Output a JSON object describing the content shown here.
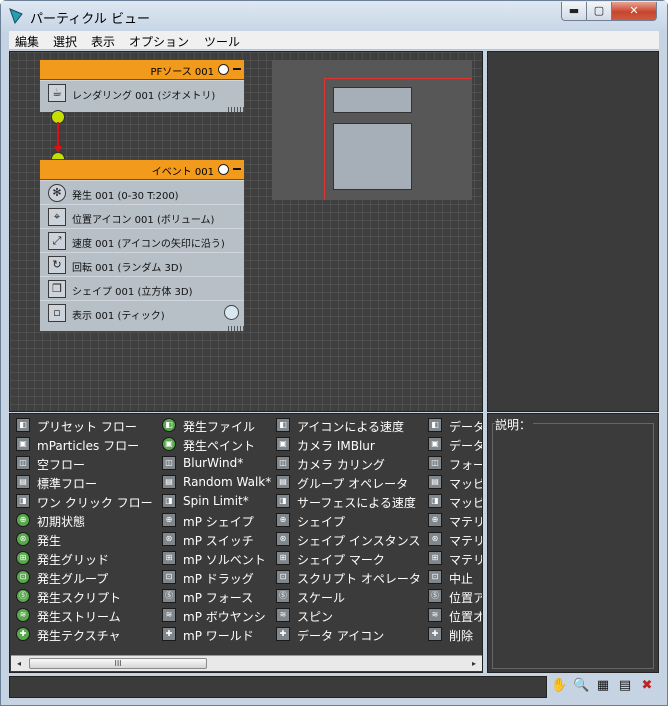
{
  "window": {
    "title": "パーティクル ビュー",
    "min_glyph": "▬",
    "max_glyph": "▢",
    "close_glyph": "✕"
  },
  "menu": [
    "編集",
    "選択",
    "表示",
    "オプション",
    "ツール"
  ],
  "source_node": {
    "title": "PFソース 001",
    "operators": [
      {
        "label": "レンダリング 001 (ジオメトリ)",
        "icon": "render-icon"
      }
    ]
  },
  "event_node": {
    "title": "イベント 001",
    "operators": [
      {
        "label": "発生 001 (0-30 T:200)",
        "icon": "birth-icon"
      },
      {
        "label": "位置アイコン 001 (ボリューム)",
        "icon": "position-icon"
      },
      {
        "label": "速度 001 (アイコンの矢印に沿う)",
        "icon": "speed-icon"
      },
      {
        "label": "回転 001 (ランダム 3D)",
        "icon": "rotation-icon"
      },
      {
        "label": "シェイプ 001 (立方体 3D)",
        "icon": "shape-icon"
      },
      {
        "label": "表示 001 (ティック)",
        "icon": "display-icon"
      }
    ]
  },
  "depot": {
    "columns": [
      [
        "プリセット フロー",
        "mParticles フロー",
        "空フロー",
        "標準フロー",
        "ワン クリック フロー",
        "初期状態",
        "発生",
        "発生グリッド",
        "発生グループ",
        "発生スクリプト",
        "発生ストリーム",
        "発生テクスチャ"
      ],
      [
        "発生ファイル",
        "発生ペイント",
        "BlurWind*",
        "Random Walk*",
        "Spin Limit*",
        "mP シェイプ",
        "mP スイッチ",
        "mP ソルベント",
        "mP ドラッグ",
        "mP フォース",
        "mP ボウヤンシ",
        "mP ワールド"
      ],
      [
        "アイコンによる速度",
        "カメラ IMBlur",
        "カメラ カリング",
        "グループ オペレータ",
        "サーフェスによる速度",
        "シェイプ",
        "シェイプ インスタンス",
        "シェイプ マーク",
        "スクリプト オペレータ",
        "スケール",
        "スピン",
        "データ アイコン"
      ],
      [
        "データ",
        "データ",
        "フォー",
        "マッピ",
        "マッピ",
        "マテリ",
        "マテリ",
        "マテリ",
        "中止",
        "位置ア",
        "位置オ",
        "削除"
      ]
    ]
  },
  "scroll": {
    "left": "◂",
    "right": "▸",
    "thumb": "III"
  },
  "description": {
    "label": "説明："
  },
  "toolbar_glyphs": [
    "✋",
    "🔍",
    "▦",
    "▤",
    "✖"
  ]
}
